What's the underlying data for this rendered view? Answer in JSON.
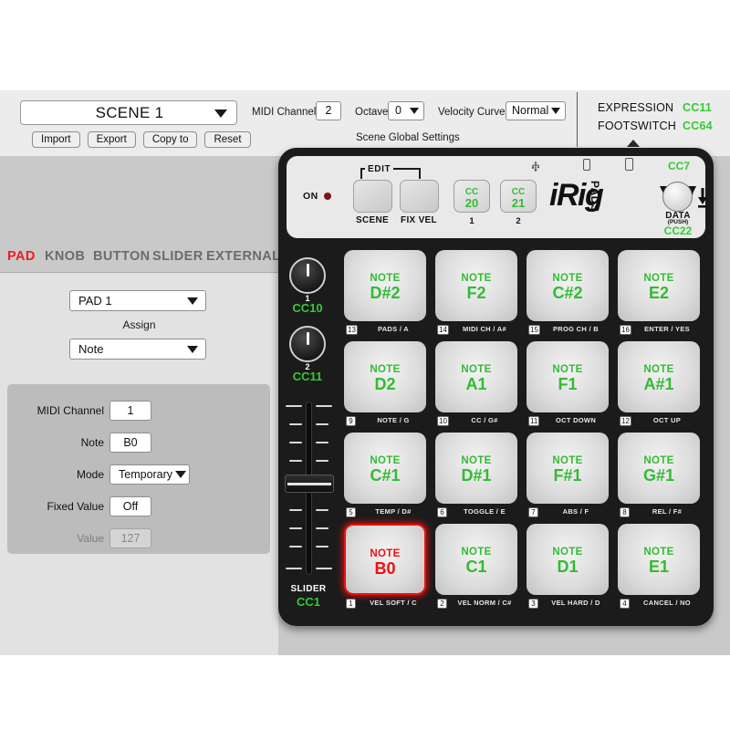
{
  "topbar": {
    "scene_label": "SCENE 1",
    "buttons": [
      "Import",
      "Export",
      "Copy to",
      "Reset"
    ],
    "midi_channel_label": "MIDI Channel",
    "midi_channel_value": "2",
    "octave_label": "Octave",
    "octave_value": "0",
    "velocity_curve_label": "Velocity Curve",
    "velocity_curve_value": "Normal",
    "scene_global_settings": "Scene Global Settings",
    "expression_label": "EXPRESSION",
    "expression_cc": "CC11",
    "footswitch_label": "FOOTSWITCH",
    "footswitch_cc": "CC64"
  },
  "tabs": [
    {
      "label": "PAD",
      "active": true
    },
    {
      "label": "KNOB",
      "active": false
    },
    {
      "label": "BUTTON",
      "active": false
    },
    {
      "label": "SLIDER",
      "active": false
    },
    {
      "label": "EXTERNAL",
      "active": false
    }
  ],
  "editor": {
    "pad_selector_value": "PAD 1",
    "assign_label": "Assign",
    "assign_value": "Note",
    "fields": [
      {
        "label": "MIDI Channel",
        "value": "1",
        "type": "text",
        "disabled": false
      },
      {
        "label": "Note",
        "value": "B0",
        "type": "text",
        "disabled": false
      },
      {
        "label": "Mode",
        "value": "Temporary",
        "type": "select",
        "disabled": false
      },
      {
        "label": "Fixed Value",
        "value": "Off",
        "type": "text",
        "disabled": false
      },
      {
        "label": "Value",
        "value": "127",
        "type": "text",
        "disabled": true
      }
    ]
  },
  "device": {
    "on_label": "ON",
    "edit_label": "EDIT",
    "buttons": [
      {
        "label": "SCENE"
      },
      {
        "label": "FIX VEL"
      }
    ],
    "cc_buttons": [
      {
        "cc_text": "CC",
        "cc_value": "20",
        "number": "1"
      },
      {
        "cc_text": "CC",
        "cc_value": "21",
        "number": "2"
      }
    ],
    "brand": "iRig",
    "brand_sub": "PADS",
    "data_knob": {
      "cc_top": "CC7",
      "label": "DATA",
      "push": "(PUSH)",
      "cc_bottom": "CC22"
    },
    "knobs": [
      {
        "number": "1",
        "cc": "CC10"
      },
      {
        "number": "2",
        "cc": "CC11"
      }
    ],
    "slider": {
      "label": "SLIDER",
      "cc": "CC1"
    },
    "pads": [
      {
        "num": "13",
        "note_label": "NOTE",
        "note": "D#2",
        "fn": "PADS / A",
        "selected": false
      },
      {
        "num": "14",
        "note_label": "NOTE",
        "note": "F2",
        "fn": "MIDI CH / A#",
        "selected": false
      },
      {
        "num": "15",
        "note_label": "NOTE",
        "note": "C#2",
        "fn": "PROG CH / B",
        "selected": false
      },
      {
        "num": "16",
        "note_label": "NOTE",
        "note": "E2",
        "fn": "ENTER / YES",
        "selected": false
      },
      {
        "num": "9",
        "note_label": "NOTE",
        "note": "D2",
        "fn": "NOTE / G",
        "selected": false
      },
      {
        "num": "10",
        "note_label": "NOTE",
        "note": "A1",
        "fn": "CC / G#",
        "selected": false
      },
      {
        "num": "11",
        "note_label": "NOTE",
        "note": "F1",
        "fn": "OCT DOWN",
        "selected": false
      },
      {
        "num": "12",
        "note_label": "NOTE",
        "note": "A#1",
        "fn": "OCT UP",
        "selected": false
      },
      {
        "num": "5",
        "note_label": "NOTE",
        "note": "C#1",
        "fn": "TEMP / D#",
        "selected": false
      },
      {
        "num": "6",
        "note_label": "NOTE",
        "note": "D#1",
        "fn": "TOGGLE / E",
        "selected": false
      },
      {
        "num": "7",
        "note_label": "NOTE",
        "note": "F#1",
        "fn": "ABS / F",
        "selected": false
      },
      {
        "num": "8",
        "note_label": "NOTE",
        "note": "G#1",
        "fn": "REL / F#",
        "selected": false
      },
      {
        "num": "1",
        "note_label": "NOTE",
        "note": "B0",
        "fn": "VEL SOFT / C",
        "selected": true
      },
      {
        "num": "2",
        "note_label": "NOTE",
        "note": "C1",
        "fn": "VEL NORM / C#",
        "selected": false
      },
      {
        "num": "3",
        "note_label": "NOTE",
        "note": "D1",
        "fn": "VEL HARD / D",
        "selected": false
      },
      {
        "num": "4",
        "note_label": "NOTE",
        "note": "E1",
        "fn": "CANCEL / NO",
        "selected": false
      }
    ]
  },
  "colors": {
    "accent_red": "#ee1c25",
    "led_green": "#33cc33",
    "panel_bg": "#c9c9c9",
    "device_black": "#1b1b1b"
  }
}
